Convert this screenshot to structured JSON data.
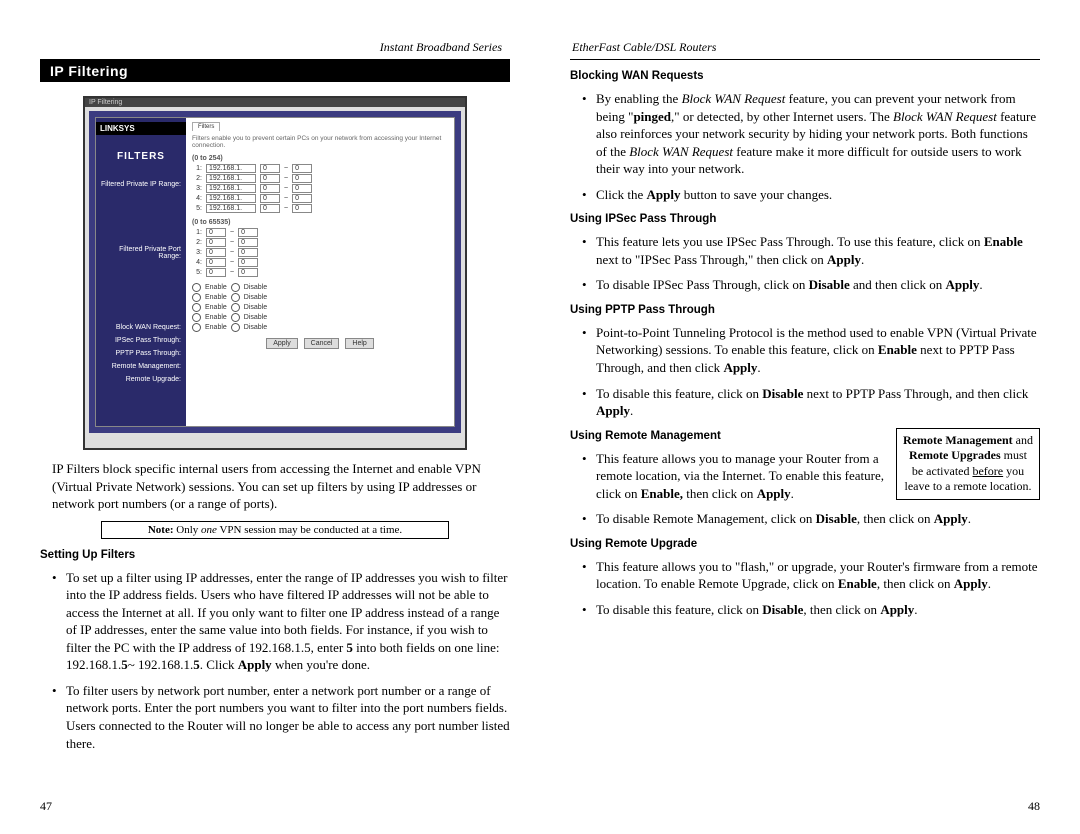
{
  "left": {
    "series_header": "Instant Broadband Series",
    "section_bar": "IP Filtering",
    "intro": "IP Filters block specific internal users from accessing the Internet and enable VPN (Virtual Private Network) sessions. You can set up filters by using IP addresses or network port numbers (or a range of ports).",
    "note_prefix": "Note:",
    "note_rest": " Only ",
    "note_italic": "one",
    "note_tail": " VPN session may be conducted at a time.",
    "h_setting": "Setting Up Filters",
    "b1_a": "To set up a filter using IP addresses, enter the range of IP addresses you wish to filter into the IP address fields. Users who have filtered IP addresses will not be able to access the Internet at all.  If you only want to filter one IP address instead of a range of IP addresses, enter the same value into both fields.  For instance, if you wish to filter the PC with the IP address of 192.168.1.5, enter ",
    "b1_b": "5",
    "b1_c": " into both fields on one line:  192.168.1.",
    "b1_d": "5",
    "b1_e": "~ 192.168.1.",
    "b1_f": "5",
    "b1_g": ". Click ",
    "b1_h": "Apply",
    "b1_i": " when you're done.",
    "b2": "To filter users by network port number, enter a network port number or a range of network ports.  Enter the port numbers you want to filter into the port numbers fields.  Users connected to the Router will no longer be able to access any port number listed there.",
    "page_num": "47",
    "screenshot": {
      "title": "IP Filtering",
      "logo": "LINKSYS",
      "filters": "FILTERS",
      "desc": "Filters enable you to prevent certain PCs on your network from accessing your Internet connection.",
      "side_private_ip": "Filtered Private IP Range:",
      "side_port_range": "Filtered Private Port Range:",
      "side_block_wan": "Block WAN Request:",
      "side_ipsec": "IPSec Pass Through:",
      "side_pptp": "PPTP Pass Through:",
      "side_remote_mgmt": "Remote Management:",
      "side_remote_upg": "Remote Upgrade:",
      "ip_range_hdr": "(0 to 254)",
      "port_hdr": "(0 to 65535)",
      "ip_prefix": "192.168.1.",
      "enable": "Enable",
      "disable": "Disable",
      "btn_apply": "Apply",
      "btn_cancel": "Cancel",
      "btn_help": "Help"
    }
  },
  "right": {
    "series_header": "EtherFast Cable/DSL Routers",
    "h_block": "Blocking WAN Requests",
    "block1_a": "By enabling the ",
    "block1_b": "Block WAN Request",
    "block1_c": " feature, you can prevent your network from being \"",
    "block1_d": "pinged",
    "block1_e": ",\" or detected, by other Internet users. The ",
    "block1_f": "Block WAN Request",
    "block1_g": " feature also reinforces your network security by hiding your network ports. Both functions of the ",
    "block1_h": "Block WAN Request",
    "block1_i": " feature make it more difficult for outside users to work their way into your network.",
    "block2_a": "Click the ",
    "block2_b": "Apply",
    "block2_c": " button to save your changes.",
    "h_ipsec": "Using IPSec Pass Through",
    "ipsec1_a": "This feature lets you use IPSec Pass Through.  To use this feature, click on ",
    "ipsec1_b": "Enable",
    "ipsec1_c": " next to \"IPSec Pass Through,\" then click on ",
    "ipsec1_d": "Apply",
    "ipsec1_e": ".",
    "ipsec2_a": "To disable IPSec Pass Through, click on ",
    "ipsec2_b": "Disable",
    "ipsec2_c": " and then click on ",
    "ipsec2_d": "Apply",
    "ipsec2_e": ".",
    "h_pptp": "Using PPTP Pass Through",
    "pptp1_a": "Point-to-Point Tunneling Protocol is the method used to enable VPN (Virtual Private Networking) sessions.  To enable this feature, click on ",
    "pptp1_b": "Enable",
    "pptp1_c": " next to PPTP Pass Through, and then click ",
    "pptp1_d": "Apply",
    "pptp1_e": ".",
    "pptp2_a": "To disable this feature, click on ",
    "pptp2_b": "Disable",
    "pptp2_c": " next to PPTP Pass Through, and then click ",
    "pptp2_d": "Apply",
    "pptp2_e": ".",
    "h_remote_mgmt": "Using Remote Management",
    "sidebox_a": "Remote Management",
    "sidebox_b": " and ",
    "sidebox_c": "Remote Upgrades",
    "sidebox_d": " must be activated ",
    "sidebox_e": "before",
    "sidebox_f": " you leave to a remote location.",
    "rmgmt1_a": "This feature allows you to manage your Router from a remote location, via the Internet.  To enable this feature, click on ",
    "rmgmt1_b": "Enable,",
    "rmgmt1_c": " then click on ",
    "rmgmt1_d": "Apply",
    "rmgmt1_e": ".",
    "rmgmt2_a": "To disable Remote Management, click on ",
    "rmgmt2_b": "Disable",
    "rmgmt2_c": ", then click on ",
    "rmgmt2_d": "Apply",
    "rmgmt2_e": ".",
    "h_remote_upg": "Using Remote Upgrade",
    "rupg1_a": "This feature allows you to \"flash,\" or upgrade, your Router's firmware from a remote location.  To enable Remote Upgrade, click on ",
    "rupg1_b": "Enable",
    "rupg1_c": ", then click on ",
    "rupg1_d": "Apply",
    "rupg1_e": ".",
    "rupg2_a": "To disable this feature, click on ",
    "rupg2_b": "Disable",
    "rupg2_c": ", then click on ",
    "rupg2_d": "Apply",
    "rupg2_e": ".",
    "page_num": "48"
  }
}
